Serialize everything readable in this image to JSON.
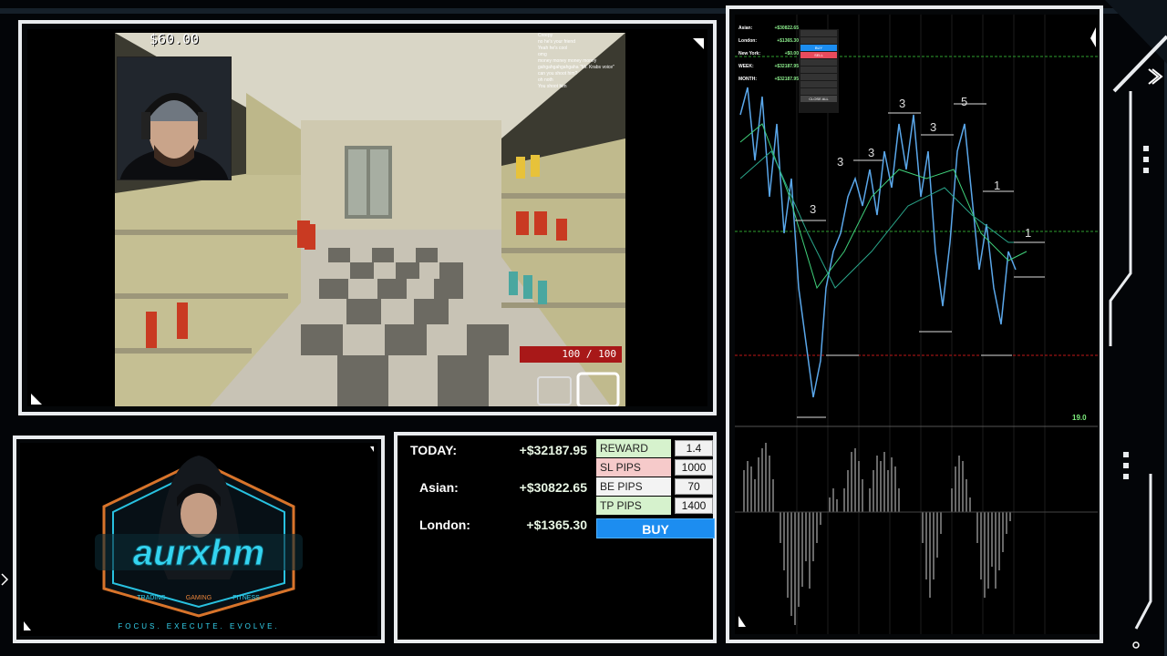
{
  "game": {
    "money": "$60.00",
    "health": "100 / 100",
    "chat": [
      {
        "user": "",
        "text": "Creepy"
      },
      {
        "user": "",
        "text": "no he's your friend"
      },
      {
        "user": "",
        "text": "Yeah he's cool"
      },
      {
        "user": "",
        "text": "omg"
      },
      {
        "user": "",
        "text": "money money money money"
      },
      {
        "user": "",
        "text": "gahgahgahgahgaha \"Mr. Krabs voice\""
      },
      {
        "user": "",
        "text": "can you shoot him?"
      },
      {
        "user": "",
        "text": "oh noth"
      },
      {
        "user": "",
        "text": "You shoot him"
      }
    ]
  },
  "stats": {
    "today_label": "TODAY:",
    "today_value": "+$32187.95",
    "asian_label": "Asian:",
    "asian_value": "+$30822.65",
    "london_label": "London:",
    "london_value": "+$1365.30"
  },
  "trade": {
    "reward_label": "REWARD",
    "reward_value": "1.4",
    "sl_label": "SL PIPS",
    "sl_value": "1000",
    "be_label": "BE PIPS",
    "be_value": "70",
    "tp_label": "TP PIPS",
    "tp_value": "1400",
    "buy_label": "BUY"
  },
  "chart_panel": {
    "accounts": [
      {
        "label": "Asian:",
        "value": "+$30822.65"
      },
      {
        "label": "London:",
        "value": "+$1365.30"
      },
      {
        "label": "New York:",
        "value": "+$0.00"
      },
      {
        "label": "WEEK:",
        "value": "+$32187.95"
      },
      {
        "label": "MONTH:",
        "value": "+$32187.95"
      }
    ],
    "mini_buttons": [
      "BUY",
      "SELL",
      "CLOSE ALL"
    ],
    "wave_labels": [
      "3",
      "3",
      "3",
      "3",
      "3",
      "5",
      "1",
      "1"
    ],
    "price_tag": "19.0",
    "colors": {
      "buy": "#1c8df0",
      "sell": "#e84b5d",
      "green": "#7ef07e",
      "red": "#e02020"
    }
  },
  "branding": {
    "name": "aurxhm",
    "pillars": [
      "TRADING",
      "GAMING",
      "FITNESS"
    ],
    "tagline": "FOCUS. EXECUTE. EVOLVE."
  }
}
